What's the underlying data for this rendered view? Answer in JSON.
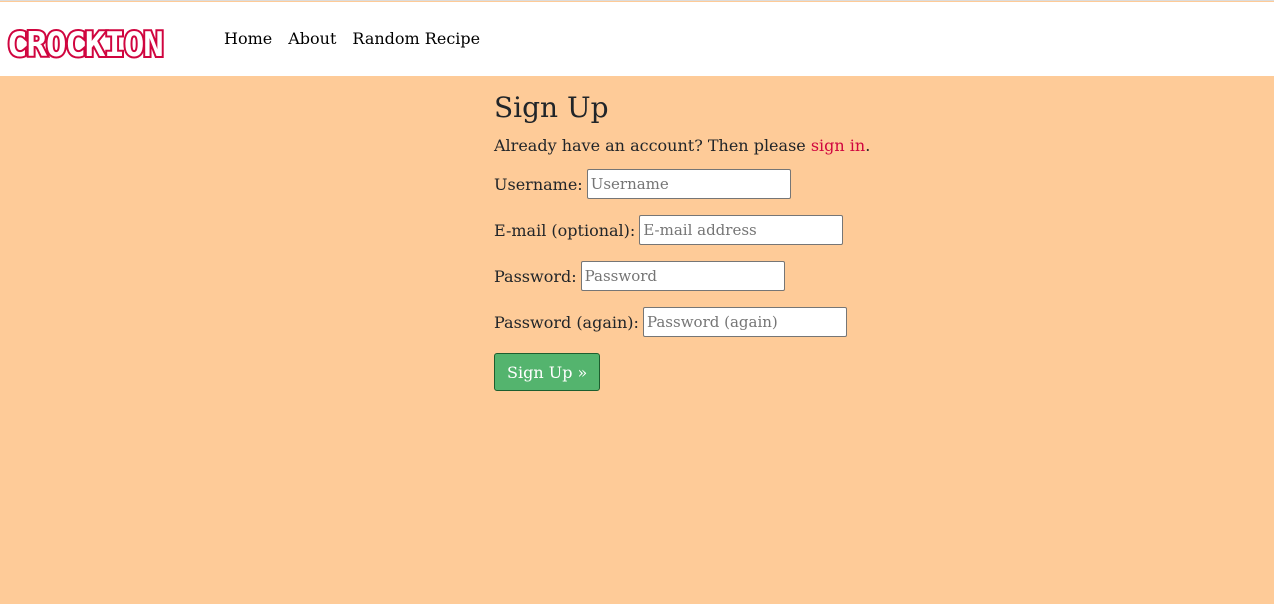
{
  "brand": {
    "logo_text": "CROCKION",
    "accent_color": "#d0053f"
  },
  "nav": {
    "items": [
      {
        "label": "Home"
      },
      {
        "label": "About"
      },
      {
        "label": "Random Recipe"
      }
    ]
  },
  "page": {
    "title": "Sign Up",
    "lead_text": "Already have an account? Then please ",
    "lead_link": "sign in",
    "lead_suffix": "."
  },
  "form": {
    "username": {
      "label": "Username:",
      "placeholder": "Username",
      "value": ""
    },
    "email": {
      "label": "E-mail (optional):",
      "placeholder": "E-mail address",
      "value": ""
    },
    "password": {
      "label": "Password:",
      "placeholder": "Password",
      "value": ""
    },
    "password2": {
      "label": "Password (again):",
      "placeholder": "Password (again)",
      "value": ""
    },
    "submit_label": "Sign Up »"
  },
  "colors": {
    "background": "#fecb98",
    "button": "#54b46e",
    "link": "#d0053f"
  }
}
